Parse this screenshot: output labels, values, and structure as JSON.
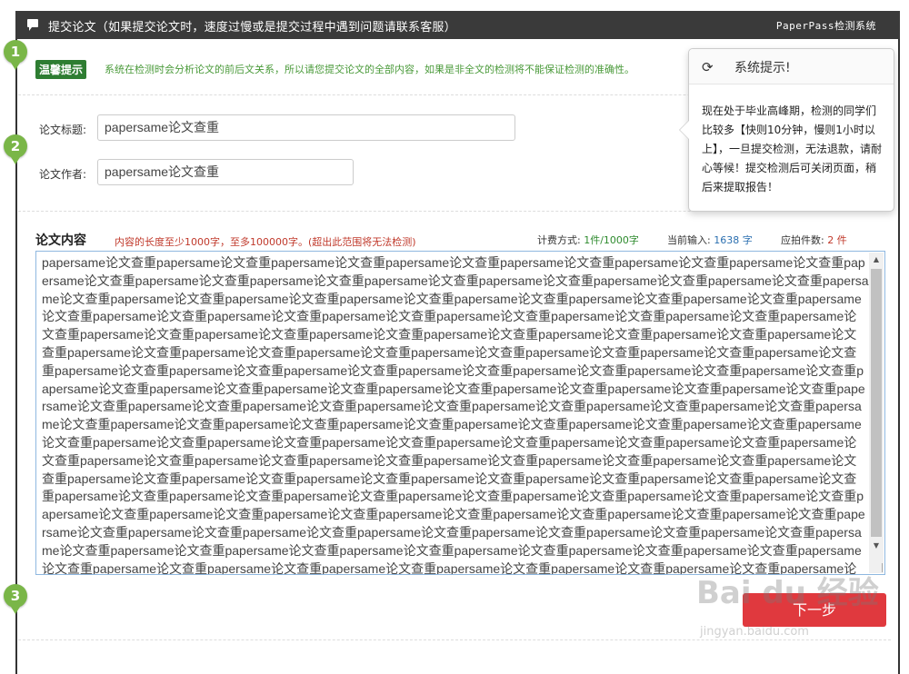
{
  "header": {
    "title": "提交论文（如果提交论文时，速度过慢或是提交过程中遇到问题请联系客服）",
    "system_name": "PaperPass检测系统"
  },
  "steps": [
    "1",
    "2",
    "3"
  ],
  "tip": {
    "badge": "温馨提示",
    "text": "系统在检测时会分析论文的前后文关系，所以请您提交论文的全部内容，如果是非全文的检测将不能保证检测的准确性。"
  },
  "popover": {
    "title": "系统提示!",
    "body": "现在处于毕业高峰期，检测的同学们比较多【快则10分钟，慢则1小时以上】，一旦提交检测，无法退款，请耐心等候！提交检测后可关闭页面，稍后来提取报告！"
  },
  "form": {
    "title_label": "论文标题:",
    "title_value": "papersame论文查重",
    "author_label": "论文作者:",
    "author_value": "papersame论文查重"
  },
  "content": {
    "label": "论文内容",
    "note": "内容的长度至少1000字，至多100000字。(超出此范围将无法检测)",
    "billing_label": "计费方式:",
    "billing_value": "1件/1000字",
    "current_label": "当前输入:",
    "current_value": "1638 字",
    "count_label": "应拍件数:",
    "count_value": "2 件",
    "text": "papersame论文查重papersame论文查重papersame论文查重papersame论文查重papersame论文查重papersame论文查重papersame论文查重papersame论文查重papersame论文查重papersame论文查重papersame论文查重papersame论文查重papersame论文查重papersame论文查重papersame论文查重papersame论文查重papersame论文查重papersame论文查重papersame论文查重papersame论文查重papersame论文查重papersame论文查重papersame论文查重papersame论文查重papersame论文查重papersame论文查重papersame论文查重papersame论文查重papersame论文查重papersame论文查重papersame论文查重papersame论文查重papersame论文查重papersame论文查重papersame论文查重papersame论文查重papersame论文查重papersame论文查重papersame论文查重papersame论文查重papersame论文查重papersame论文查重papersame论文查重papersame论文查重papersame论文查重papersame论文查重papersame论文查重papersame论文查重papersame论文查重papersame论文查重papersame论文查重papersame论文查重papersame论文查重papersame论文查重papersame论文查重papersame论文查重papersame论文查重papersame论文查重papersame论文查重papersame论文查重papersame论文查重papersame论文查重papersame论文查重papersame论文查重papersame论文查重papersame论文查重papersame论文查重papersame论文查重papersame论文查重papersame论文查重papersame论文查重papersame论文查重papersame论文查重papersame论文查重papersame论文查重papersame论文查重papersame论文查重papersame论文查重papersame论文查重papersame论文查重papersame论文查重papersame论文查重papersame论文查重papersame论文查重papersame论文查重papersame论文查重papersame论文查重papersame论文查重papersame论文查重papersame论文查重papersame论文查重papersame论文查重papersame论文查重papersame论文查重papersame论文查重papersame论文查重papersame论文查重papersame论文查重papersame论文查重papersame论文查重papersame论文查重papersame论文查重papersame论文查重papersame论文查重papersame论文查重papersame论文查重papersame论文查重papersame论文查重papersame论文查重papersame论文查重papersame论文查重papersame论文查重papersame论文查重papersame论文查重papersame论文查重papersame论文查重papersame论文查重papersame论文查重papersame论文查重papersame论文查重papersame论文查重papersame论文查重papersame论文查重papersame论文查重papersame论文查重papersame论文查重papersame论文查重papersame论文查重papersame论文查重papersame论文查重papersame论文查重papersame论文查重papersame论文查重papersame论文查重papersame论文查重papersame论文查重papersame论文查重papersame论文查重papersame论文查重papersame论文查重papersame论文查重papersame论文查重papersame论文查重papersame论文查重papersame论文查重papersame论文查重papersame论文查重papersame论文查重papersame论文查重papersame论文查重papersame论文查重papersame论文查重papersame论文查重papersame论文查重papersame论文查重papersame论文查重papersame论文查重papersame论文查重papersame论文查重papersame论文查重papersame论文查重papersame论文查重papersame论文查重papersame论文查重papersame论文查重papersame论文查重papersame论文查重"
  },
  "submit_label": "下一步",
  "watermark": {
    "logo": "Bai du 经验",
    "url": "jingyan.baidu.com"
  },
  "icons": {
    "header": "message-icon",
    "popover": "refresh-icon"
  },
  "colors": {
    "header_bg": "#3a3a3a",
    "step_green": "#7ab648",
    "submit_red": "#e0393e",
    "note_red": "#c0392b"
  }
}
